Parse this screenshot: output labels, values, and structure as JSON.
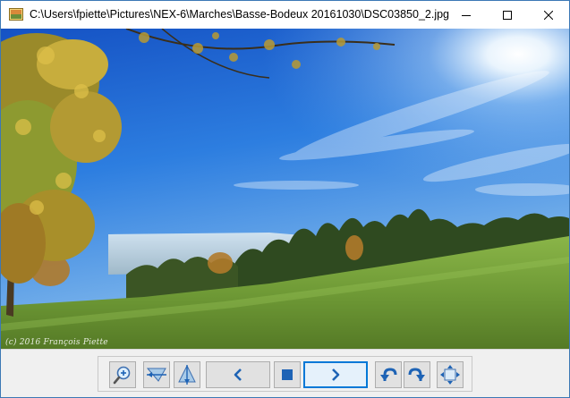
{
  "window": {
    "title": "C:\\Users\\fpiette\\Pictures\\NEX-6\\Marches\\Basse-Bodeux 20161030\\DSC03850_2.jpg",
    "controls": [
      "minimize",
      "maximize",
      "close"
    ]
  },
  "image": {
    "watermark": "(c) 2016 François Piette",
    "description_icon": "landscape-photo"
  },
  "toolbar": {
    "buttons": [
      {
        "name": "zoom-button",
        "icon": "magnifier-plus-icon"
      },
      {
        "name": "flip-horizontal-button",
        "icon": "flip-horizontal-icon"
      },
      {
        "name": "flip-vertical-button",
        "icon": "flip-vertical-icon"
      },
      {
        "name": "previous-button",
        "icon": "arrow-left-icon"
      },
      {
        "name": "stop-button",
        "icon": "stop-icon"
      },
      {
        "name": "next-button",
        "icon": "arrow-right-icon"
      },
      {
        "name": "rotate-left-button",
        "icon": "rotate-left-icon"
      },
      {
        "name": "rotate-right-button",
        "icon": "rotate-right-icon"
      },
      {
        "name": "fit-to-window-button",
        "icon": "move-arrows-icon"
      }
    ]
  },
  "colors": {
    "accent": "#0078d7",
    "icon_blue": "#1e63b5"
  }
}
